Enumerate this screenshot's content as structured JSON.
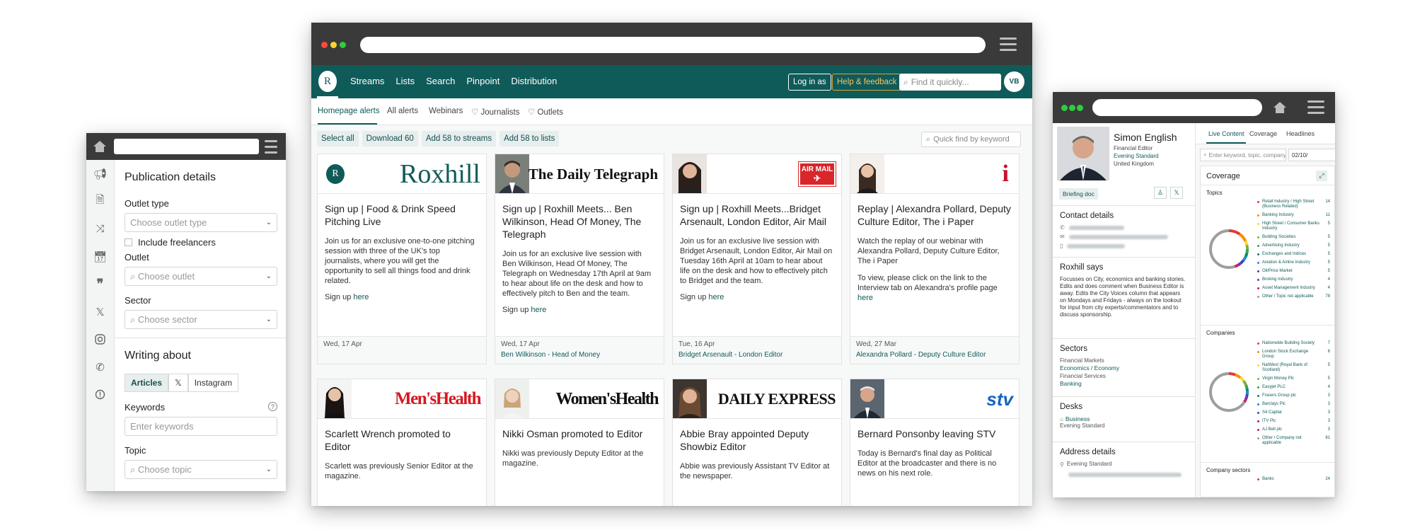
{
  "left_window": {
    "section_title": "Publication details",
    "outlet_type_label": "Outlet type",
    "outlet_type_placeholder": "Choose outlet type",
    "include_freelancers": "Include freelancers",
    "outlet_label": "Outlet",
    "outlet_placeholder": "Choose outlet",
    "sector_label": "Sector",
    "sector_placeholder": "Choose sector",
    "writing_about_title": "Writing about",
    "tabs": [
      "Articles",
      "𝕏",
      "Instagram"
    ],
    "keywords_label": "Keywords",
    "keywords_placeholder": "Enter keywords",
    "topic_label": "Topic",
    "topic_placeholder": "Choose topic",
    "rail_icons": [
      "megaphone-icon",
      "document-icon",
      "shuffle-icon",
      "calendar-icon",
      "quote-icon",
      "x-icon",
      "instagram-icon",
      "phone-icon",
      "alert-icon"
    ]
  },
  "main_window": {
    "nav": {
      "logo": "R",
      "links": [
        "Streams",
        "Lists",
        "Search",
        "Pinpoint",
        "Distribution"
      ],
      "login_as": "Log in as",
      "help": "Help & feedback",
      "search_placeholder": "Find it quickly...",
      "avatar": "VB"
    },
    "subnav": [
      "Homepage alerts",
      "All alerts",
      "Webinars",
      "Journalists",
      "Outlets"
    ],
    "actions": [
      "Select all",
      "Download 60",
      "Add 58 to streams",
      "Add 58 to lists"
    ],
    "quick_find": "Quick find by keyword",
    "cards": [
      {
        "publication": "Roxhill",
        "title": "Sign up | Food & Drink Speed Pitching Live",
        "text": "Join us for an exclusive one-to-one pitching session with three of the UK's top journalists, where you will get the opportunity to sell all things food and drink related.",
        "signup": "Sign up",
        "link": "here",
        "date": "Wed, 17 Apr",
        "person": ""
      },
      {
        "publication": "The Daily Telegraph",
        "title": "Sign up | Roxhill Meets... Ben Wilkinson, Head Of Money, The Telegraph",
        "text": "Join us for an exclusive live session with Ben Wilkinson, Head Of Money, The Telegraph on Wednesday 17th April at 9am to hear about life on the desk and how to effectively pitch to Ben and the team.",
        "signup": "Sign up",
        "link": "here",
        "date": "Wed, 17 Apr",
        "person": "Ben Wilkinson - Head of Money"
      },
      {
        "publication": "AIR MAIL",
        "title": "Sign up | Roxhill Meets...Bridget Arsenault, London Editor, Air Mail",
        "text": "Join us for an exclusive live session with Bridget Arsenault, London Editor, Air Mail on Tuesday 16th April at 10am to hear about life on the desk and how to effectively pitch to Bridget and the team.",
        "signup": "Sign up",
        "link": "here",
        "date": "Tue, 16 Apr",
        "person": "Bridget Arsenault - London Editor"
      },
      {
        "publication": "i",
        "title": "Replay | Alexandra Pollard, Deputy Culture Editor, The i Paper",
        "text": "Watch the replay of our webinar with Alexandra Pollard, Deputy Culture Editor, The i Paper",
        "text2": "To view, please click on the link to the Interview tab on Alexandra's profile page",
        "link": "here",
        "date": "Wed, 27 Mar",
        "person": "Alexandra Pollard - Deputy Culture Editor"
      },
      {
        "publication": "Men'sHealth",
        "title": "Scarlett Wrench promoted to Editor",
        "text": "Scarlett was previously Senior Editor at the magazine."
      },
      {
        "publication": "Women'sHealth",
        "title": "Nikki Osman promoted to Editor",
        "text": "Nikki was previously Deputy Editor at the magazine."
      },
      {
        "publication": "DAILY EXPRESS",
        "title": "Abbie Bray appointed Deputy Showbiz Editor",
        "text": "Abbie was previously Assistant TV Editor at the newspaper."
      },
      {
        "publication": "stv",
        "title": "Bernard Ponsonby leaving STV",
        "text": "Today is Bernard's final day as Political Editor at the broadcaster and there is no news on his next role."
      }
    ]
  },
  "right_window": {
    "profile": {
      "name": "Simon English",
      "role": "Financial Editor",
      "outlet": "Evening Standard",
      "location": "United Kingdom",
      "briefing": "Briefing doc"
    },
    "contact_title": "Contact details",
    "roxhill_says_title": "Roxhill says",
    "roxhill_says": "Focusses on City, economics and banking stories. Edits and does comment when Business Editor is away. Edits the City Voices column that appears on Mondays and Fridays - always on the lookout for input from city experts/commentators and to discuss sponsorship.",
    "sectors_title": "Sectors",
    "sectors": [
      {
        "group": "Financial Markets",
        "item": "Economics / Economy"
      },
      {
        "group": "Financial Services",
        "item": "Banking"
      }
    ],
    "desks_title": "Desks",
    "desk": "Business",
    "desk_outlet": "Evening Standard",
    "address_title": "Address details",
    "address_outlet": "Evening Standard",
    "tabs": [
      "Live Content",
      "Coverage",
      "Headlines"
    ],
    "search_placeholder": "Enter keyword, topic, company",
    "date_value": "02/10/",
    "coverage_title": "Coverage",
    "topics_title": "Topics",
    "topics": [
      {
        "label": "Retail Industry / High Street (Business Related)",
        "n": "14",
        "color": "#e53935"
      },
      {
        "label": "Banking Industry",
        "n": "11",
        "color": "#fb8c00"
      },
      {
        "label": "High Street / Consumer Banks Industry",
        "n": "5",
        "color": "#fdd835"
      },
      {
        "label": "Building Societies",
        "n": "5",
        "color": "#7cb342"
      },
      {
        "label": "Advertising Industry",
        "n": "5",
        "color": "#43a047"
      },
      {
        "label": "Exchanges and Indices",
        "n": "5",
        "color": "#00897b"
      },
      {
        "label": "Aviation & Airline Industry",
        "n": "5",
        "color": "#1e88e5"
      },
      {
        "label": "Oil/Price Market",
        "n": "5",
        "color": "#3949ab"
      },
      {
        "label": "Broking Industry",
        "n": "4",
        "color": "#8e24aa"
      },
      {
        "label": "Asset Management Industry",
        "n": "4",
        "color": "#d81b60"
      },
      {
        "label": "Other / Topic not applicable",
        "n": "78",
        "color": "#9e9e9e"
      }
    ],
    "companies_title": "Companies",
    "companies": [
      {
        "label": "Nationwide Building Society",
        "n": "7",
        "color": "#e53935"
      },
      {
        "label": "London Stock Exchange Group",
        "n": "6",
        "color": "#fb8c00"
      },
      {
        "label": "NatWest (Royal Bank of Scotland)",
        "n": "5",
        "color": "#fdd835"
      },
      {
        "label": "Virgin Money Plc",
        "n": "5",
        "color": "#7cb342"
      },
      {
        "label": "Easyjet PLC",
        "n": "4",
        "color": "#43a047"
      },
      {
        "label": "Frasers Group plc",
        "n": "3",
        "color": "#00897b"
      },
      {
        "label": "Barclays Plc",
        "n": "3",
        "color": "#1e88e5"
      },
      {
        "label": "S4 Capital",
        "n": "3",
        "color": "#3949ab"
      },
      {
        "label": "ITV Plc",
        "n": "3",
        "color": "#8e24aa"
      },
      {
        "label": "AJ Bell plc",
        "n": "3",
        "color": "#d81b60"
      },
      {
        "label": "Other / Company not applicable",
        "n": "81",
        "color": "#9e9e9e"
      }
    ],
    "company_sectors_title": "Company sectors",
    "company_sectors": [
      {
        "label": "Banks",
        "n": "24",
        "color": "#e53935"
      }
    ]
  },
  "colors": {
    "brand": "#0f5b59",
    "chrome": "#3a3a3a",
    "help_border": "#d9a441"
  }
}
